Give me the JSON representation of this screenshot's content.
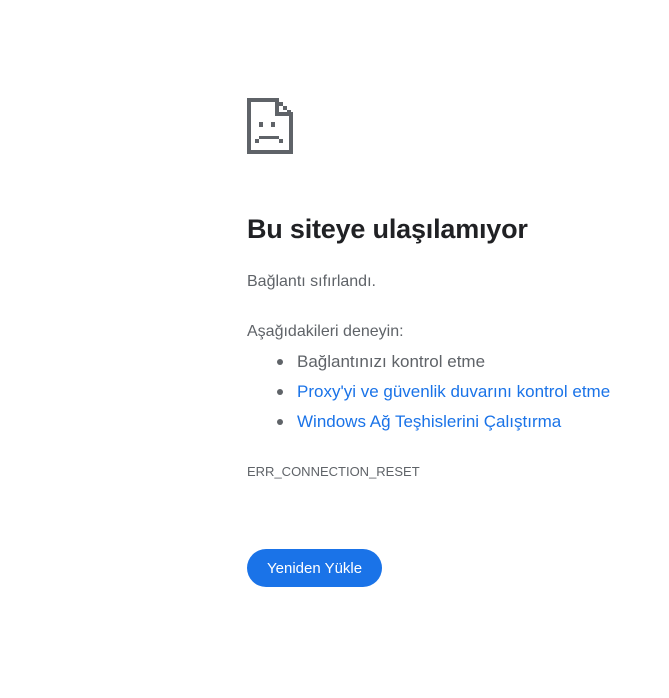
{
  "icon": "sad-page-icon",
  "title": "Bu siteye ulaşılamıyor",
  "subtitle": "Bağlantı sıfırlandı.",
  "suggestions": {
    "heading": "Aşağıdakileri deneyin:",
    "items": [
      {
        "label": "Bağlantınızı kontrol etme"
      },
      {
        "label": "Proxy'yi ve güvenlik duvarını kontrol etme"
      },
      {
        "label": "Windows Ağ Teşhislerini Çalıştırma"
      }
    ]
  },
  "error_code": "ERR_CONNECTION_RESET",
  "reload_button": {
    "label": "Yeniden Yükle"
  },
  "colors": {
    "link": "#1a73e8",
    "button_bg": "#1a73e8",
    "text_secondary": "#5f6368",
    "title": "#202124"
  }
}
